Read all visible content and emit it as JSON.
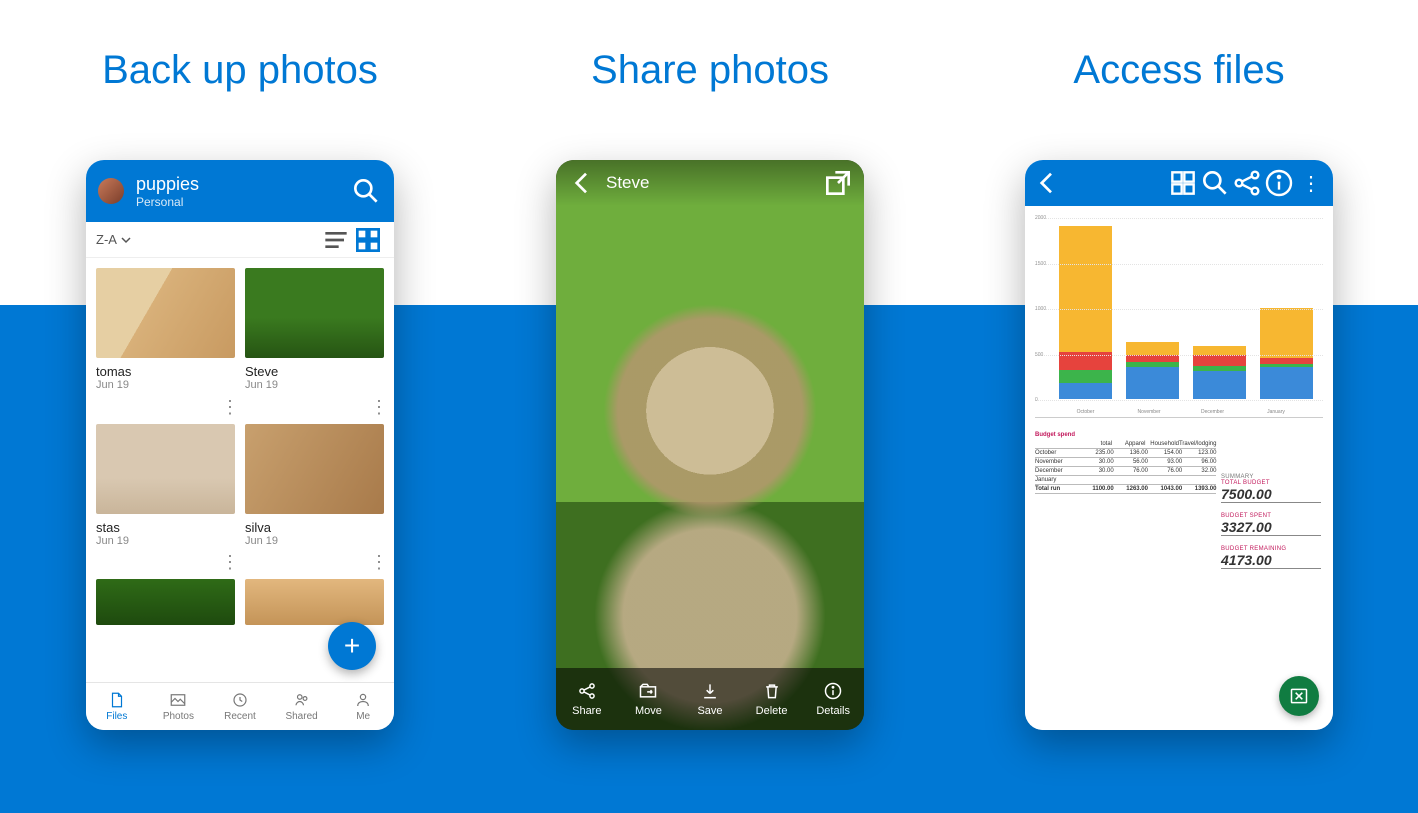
{
  "panels": {
    "p1": {
      "title": "Back up photos"
    },
    "p2": {
      "title": "Share photos"
    },
    "p3": {
      "title": "Access files"
    }
  },
  "files_app": {
    "folder_title": "puppies",
    "account_label": "Personal",
    "sort_label": "Z-A",
    "items": [
      {
        "name": "tomas",
        "date": "Jun 19"
      },
      {
        "name": "Steve",
        "date": "Jun 19"
      },
      {
        "name": "stas",
        "date": "Jun 19"
      },
      {
        "name": "silva",
        "date": "Jun 19"
      }
    ],
    "tabs": [
      {
        "label": "Files",
        "active": true
      },
      {
        "label": "Photos",
        "active": false
      },
      {
        "label": "Recent",
        "active": false
      },
      {
        "label": "Shared",
        "active": false
      },
      {
        "label": "Me",
        "active": false
      }
    ]
  },
  "photo_viewer": {
    "title": "Steve",
    "actions": [
      {
        "label": "Share"
      },
      {
        "label": "Move"
      },
      {
        "label": "Save"
      },
      {
        "label": "Delete"
      },
      {
        "label": "Details"
      }
    ]
  },
  "file_viewer": {
    "budget_table": {
      "title": "Budget spend",
      "columns": [
        "",
        "total",
        "Apparel",
        "Household",
        "Travel/lodging"
      ],
      "rows": [
        [
          "October",
          "235.00",
          "136.00",
          "154.00",
          "123.00"
        ],
        [
          "November",
          "30.00",
          "56.00",
          "93.00",
          "96.00"
        ],
        [
          "December",
          "30.00",
          "76.00",
          "76.00",
          "32.00"
        ],
        [
          "January",
          "",
          "",
          "",
          ""
        ]
      ],
      "total_row": [
        "Total run",
        "1100.00",
        "1263.00",
        "1043.00",
        "1393.00"
      ]
    },
    "summary": {
      "heading": "SUMMARY",
      "total_budget_label": "TOTAL BUDGET",
      "total_budget_value": "7500.00",
      "spent_label": "BUDGET SPENT",
      "spent_value": "3327.00",
      "remaining_label": "BUDGET REMAINING",
      "remaining_value": "4173.00"
    }
  },
  "chart_data": {
    "type": "bar",
    "stacked": true,
    "categories": [
      "October",
      "November",
      "December",
      "January"
    ],
    "series": [
      {
        "name": "blue",
        "color": "#3b8ad9",
        "values": [
          180,
          350,
          310,
          350
        ]
      },
      {
        "name": "green",
        "color": "#3cb44b",
        "values": [
          140,
          60,
          50,
          30
        ]
      },
      {
        "name": "red",
        "color": "#e6433d",
        "values": [
          200,
          70,
          120,
          70
        ]
      },
      {
        "name": "yellow",
        "color": "#f7b731",
        "values": [
          1380,
          150,
          100,
          550
        ]
      }
    ],
    "ylim": [
      0,
      2000
    ],
    "yticks": [
      0,
      500,
      1000,
      1500,
      2000
    ],
    "title": "",
    "xlabel": "",
    "ylabel": ""
  }
}
